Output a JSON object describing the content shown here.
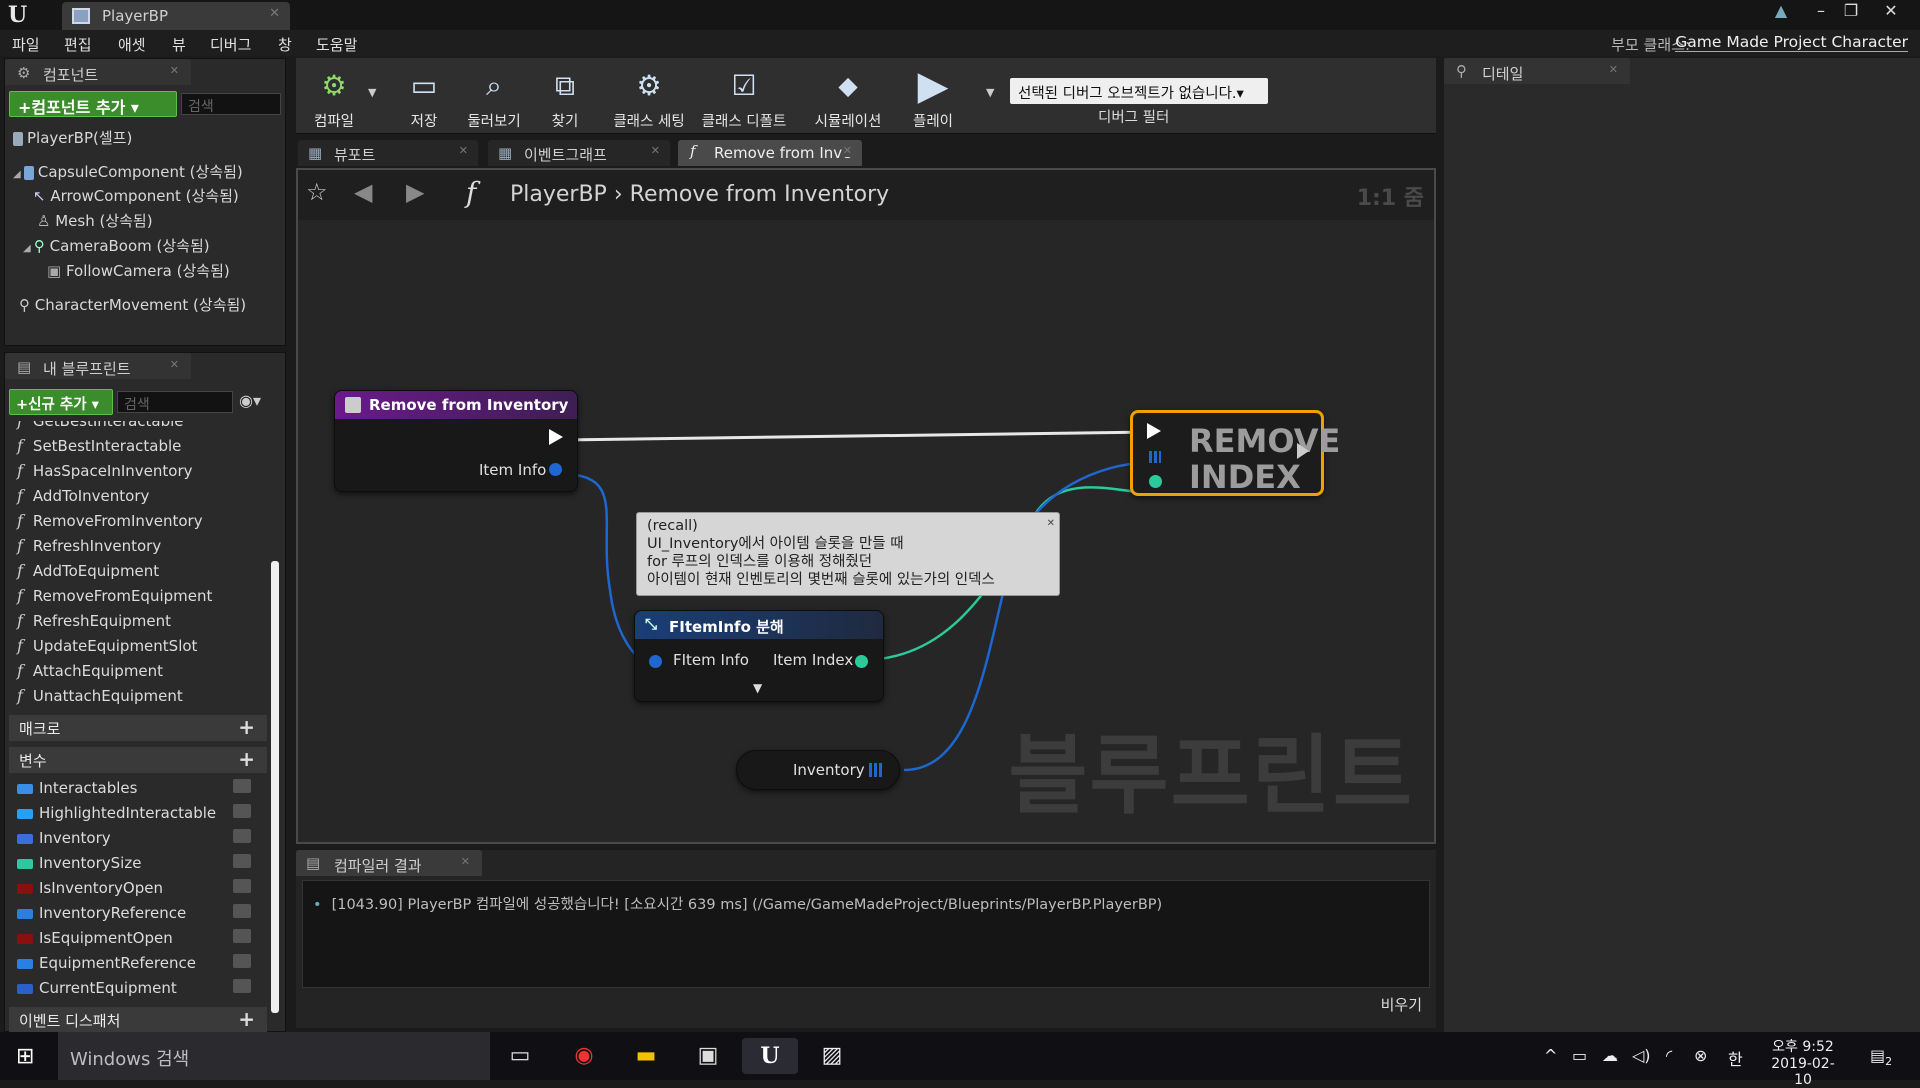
{
  "window": {
    "tab_title": "PlayerBP",
    "parent_class_label": "부모 클래스:",
    "parent_class": "Game Made Project Character"
  },
  "menu": [
    "파일",
    "편집",
    "애셋",
    "뷰",
    "디버그",
    "창",
    "도움말"
  ],
  "components": {
    "tab": "컴포넌트",
    "add_button": "+컴포넌트 추가 ▾",
    "search_placeholder": "검색",
    "self": "PlayerBP(셀프)",
    "tree": [
      "CapsuleComponent (상속됨)",
      "ArrowComponent (상속됨)",
      "Mesh (상속됨)",
      "CameraBoom (상속됨)",
      "FollowCamera (상속됨)",
      "CharacterMovement (상속됨)"
    ]
  },
  "my_blueprint": {
    "tab": "내 블루프린트",
    "add_new": "+신규 추가 ▾",
    "search_placeholder": "검색",
    "functions": [
      "GetBestInteractable",
      "SetBestInteractable",
      "HasSpaceInInventory",
      "AddToInventory",
      "RemoveFromInventory",
      "RefreshInventory",
      "AddToEquipment",
      "RemoveFromEquipment",
      "RefreshEquipment",
      "UpdateEquipmentSlot",
      "AttachEquipment",
      "UnattachEquipment"
    ],
    "macros_label": "매크로",
    "variables_label": "변수",
    "variables": [
      {
        "name": "Interactables",
        "color": "#3a8ee6"
      },
      {
        "name": "HighlightedInteractable",
        "color": "#2a9ef0"
      },
      {
        "name": "Inventory",
        "color": "#3a6fd8"
      },
      {
        "name": "InventorySize",
        "color": "#2ec9a0"
      },
      {
        "name": "IsInventoryOpen",
        "color": "#8a1010"
      },
      {
        "name": "InventoryReference",
        "color": "#2a7fe0"
      },
      {
        "name": "IsEquipmentOpen",
        "color": "#8a1010"
      },
      {
        "name": "EquipmentReference",
        "color": "#2a7fe0"
      },
      {
        "name": "CurrentEquipment",
        "color": "#2a60c8"
      }
    ],
    "dispatchers_label": "이벤트 디스패처"
  },
  "toolbar": {
    "buttons": [
      "컴파일",
      "저장",
      "둘러보기",
      "찾기",
      "클래스 세팅",
      "클래스 디폴트",
      "시뮬레이션",
      "플레이"
    ],
    "debug_select": "선택된 디버그 오브젝트가 없습니다.▾",
    "debug_filter": "디버그 필터"
  },
  "graph_tabs": [
    "뷰포트",
    "이벤트그래프",
    "Remove from Inve"
  ],
  "breadcrumb": {
    "root": "PlayerBP",
    "sep": "›",
    "current": "Remove from Inventory",
    "zoom": "1:1 줌"
  },
  "watermark": "블루프린트",
  "nodes": {
    "entry": {
      "title": "Remove from Inventory",
      "pin": "Item Info"
    },
    "breakstruct": {
      "title": "FItemInfo 분해",
      "in_pin": "FItem Info",
      "out_pin": "Item Index"
    },
    "comment": {
      "lines": [
        "(recall)",
        "UI_Inventory에서 아이템 슬롯을 만들 때",
        "for 루프의 인덱스를 이용해 정해줬던",
        "아이템이 현재 인벤토리의 몇번째 슬롯에 있는가의 인덱스"
      ]
    },
    "inventory_var": {
      "label": "Inventory"
    },
    "remove_index": {
      "line1": "REMOVE",
      "line2": "INDEX"
    }
  },
  "compiler": {
    "tab": "컴파일러 결과",
    "message": "[1043.90] PlayerBP 컴파일에 성공했습니다! [소요시간 639 ms] (/Game/GameMadeProject/Blueprints/PlayerBP.PlayerBP)",
    "clear": "비우기"
  },
  "details": {
    "tab": "디테일"
  },
  "taskbar": {
    "search": "Windows 검색",
    "time": "오후 9:52",
    "date": "2019-02-10",
    "ime": "한",
    "notif": "2"
  }
}
